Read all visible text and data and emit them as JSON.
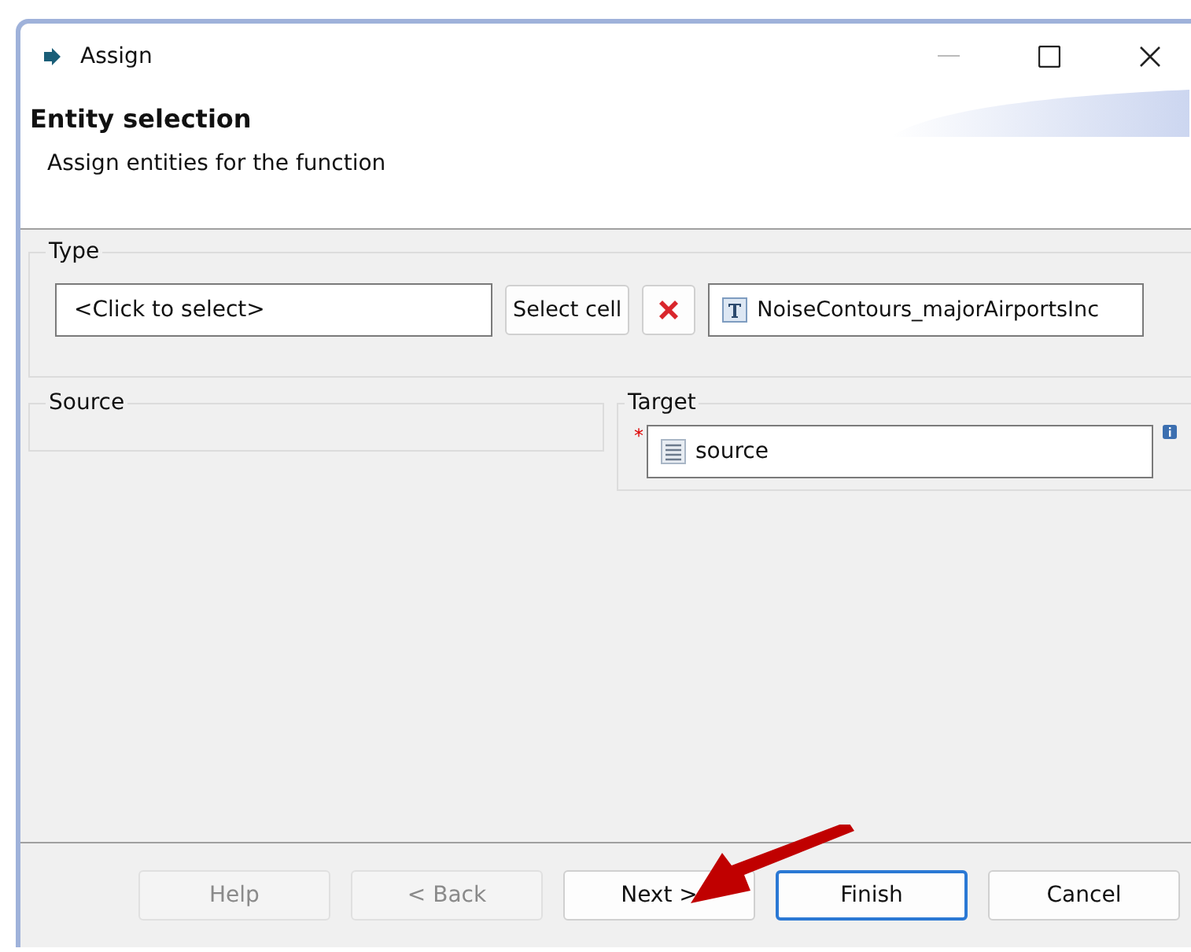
{
  "window": {
    "title": "Assign"
  },
  "header": {
    "title": "Entity selection",
    "description": "Assign entities for the function"
  },
  "type_group": {
    "label": "Type",
    "selector": {
      "value": "<Click to select>"
    },
    "select_button": "Select cell",
    "type_value": "NoiseContours_majorAirportsInc"
  },
  "source_group": {
    "label": "Source"
  },
  "target_group": {
    "label": "Target",
    "required_mark": "*",
    "field": {
      "value": "source"
    }
  },
  "buttons": [
    {
      "label": "Help",
      "disabled": true,
      "focused": false
    },
    {
      "label": "< Back",
      "disabled": true,
      "focused": false
    },
    {
      "label": "Next >",
      "disabled": false,
      "focused": false
    },
    {
      "label": "Finish",
      "disabled": false,
      "focused": true
    },
    {
      "label": "Cancel",
      "disabled": false,
      "focused": false
    }
  ]
}
